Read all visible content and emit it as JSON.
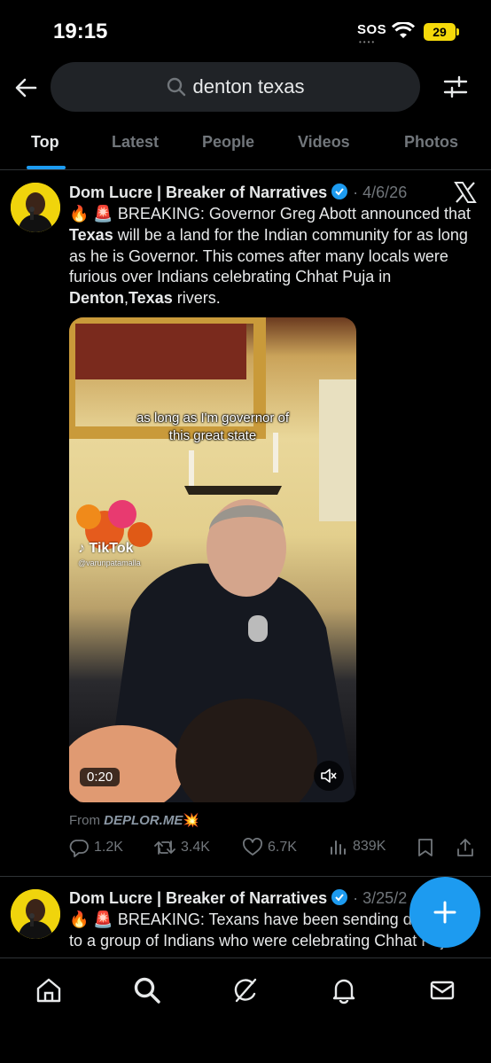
{
  "status_bar": {
    "time": "19:15",
    "sos": "SOS",
    "battery": "29"
  },
  "search": {
    "query": "denton texas"
  },
  "tabs": [
    {
      "label": "Top",
      "active": true
    },
    {
      "label": "Latest",
      "active": false
    },
    {
      "label": "People",
      "active": false
    },
    {
      "label": "Videos",
      "active": false
    },
    {
      "label": "Photos",
      "active": false
    }
  ],
  "tweets": [
    {
      "author": "Dom Lucre | Breaker of Narratives",
      "date": "4/6/26",
      "text_parts": {
        "p1": "🔥 🚨 BREAKING: Governor Greg Abott announced that ",
        "b1": "Texas",
        "p2": " will be a land for the Indian community for as long as he is Governor. This comes after many locals were furious over Indians celebrating Chhat Puja in ",
        "b2": "Denton",
        "p3": ",",
        "b3": "Texas",
        "p4": " rivers."
      },
      "video": {
        "caption": "as long as I'm governor of this great state",
        "tiktok_label": "TikTok",
        "tiktok_user": "@varunpatamalla",
        "duration": "0:20"
      },
      "source": {
        "prefix": "From ",
        "name": "DEPLOR.ME",
        "emoji": "💥"
      },
      "stats": {
        "replies": "1.2K",
        "reposts": "3.4K",
        "likes": "6.7K",
        "views": "839K"
      }
    },
    {
      "author": "Dom Lucre | Breaker of Narratives",
      "date": "3/25/2",
      "text_line1": "🔥 🚨 BREAKING: Texans have been sending d",
      "text_line2": "to a group of Indians who were celebrating Chhat Puja"
    }
  ],
  "colors": {
    "accent": "#1d9bf0",
    "background": "#000000",
    "muted_text": "#71767b",
    "avatar_bg": "#f0d40c"
  }
}
